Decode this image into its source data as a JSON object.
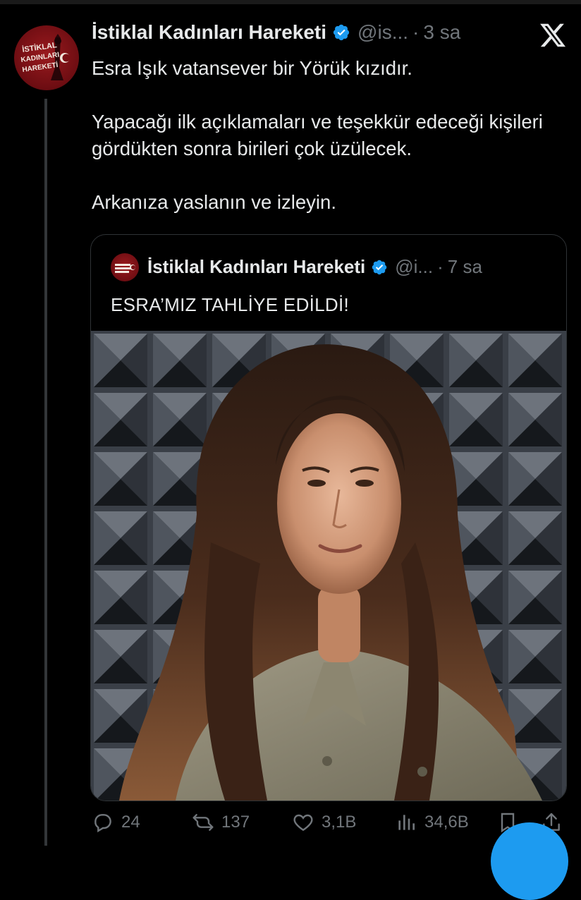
{
  "tweet": {
    "author_name": "İstiklal Kadınları Hareketi",
    "handle": "@is...",
    "separator": "·",
    "time": "3 sa",
    "paragraphs": [
      "Esra Işık vatansever bir Yörük kızıdır.",
      "Yapacağı ilk açıklamaları ve teşekkür edeceği kişileri gördükten sonra birileri çok üzülecek.",
      "Arkanıza yaslanın ve izleyin."
    ],
    "avatar_logo_text": "İSTİKLAL KADINLARI HAREKETİ"
  },
  "quoted": {
    "author_name": "İstiklal Kadınları Hareketi",
    "handle": "@i...",
    "separator": "·",
    "time": "7 sa",
    "text": "ESRA’MIZ TAHLİYE EDİLDİ!"
  },
  "actions": {
    "replies": "24",
    "reposts": "137",
    "likes": "3,1B",
    "views": "34,6B"
  },
  "colors": {
    "background": "#000000",
    "text": "#e7e9ea",
    "muted": "#71767b",
    "accent": "#1d9bf0",
    "avatar_red": "#7a0f14"
  },
  "icons": [
    "verified-badge-icon",
    "x-logo-icon",
    "reply-icon",
    "repost-icon",
    "like-icon",
    "views-icon",
    "bookmark-icon",
    "share-icon"
  ]
}
